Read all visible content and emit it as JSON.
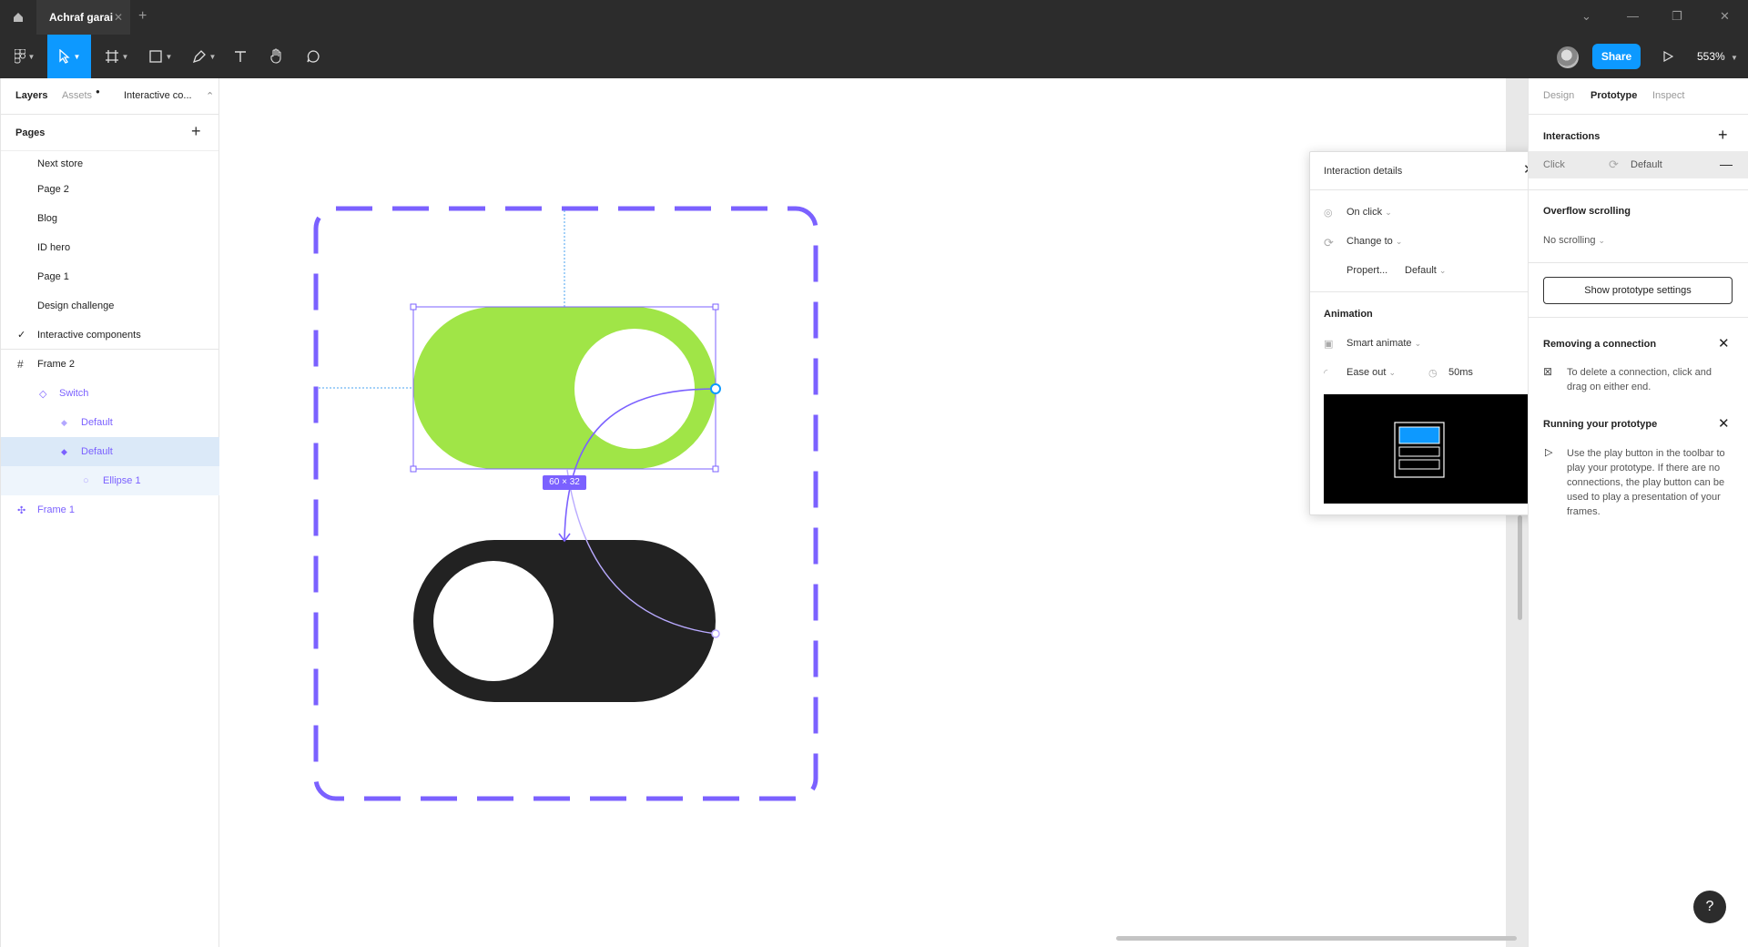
{
  "window": {
    "tab_title": "Achraf garai"
  },
  "toolbar": {
    "share_label": "Share",
    "zoom": "553%"
  },
  "left_panel": {
    "tabs": [
      "Layers",
      "Assets",
      "Interactive co..."
    ],
    "pages_title": "Pages",
    "pages": [
      "Next store",
      "Page 2",
      "Blog",
      "ID hero",
      "Page 1",
      "Design challenge",
      "Interactive components"
    ],
    "layers": [
      "Frame 2",
      "Switch",
      "Default",
      "Default",
      "Ellipse 1",
      "Frame 1"
    ]
  },
  "canvas": {
    "size_badge": "60 × 32"
  },
  "interaction_details": {
    "title": "Interaction details",
    "trigger": "On click",
    "action": "Change to",
    "property_label": "Propert...",
    "property_value": "Default",
    "animation_title": "Animation",
    "animation_type": "Smart animate",
    "easing": "Ease out",
    "duration": "50ms"
  },
  "right_panel": {
    "tabs": [
      "Design",
      "Prototype",
      "Inspect"
    ],
    "interactions_title": "Interactions",
    "interaction_trigger": "Click",
    "interaction_target": "Default",
    "overflow_title": "Overflow scrolling",
    "overflow_value": "No scrolling",
    "settings_button": "Show prototype settings",
    "removing_title": "Removing a connection",
    "removing_text": "To delete a connection, click and drag on either end.",
    "running_title": "Running your prototype",
    "running_text": "Use the play button in the toolbar to play your prototype. If there are no connections, the play button can be used to play a presentation of your frames."
  },
  "colors": {
    "accent": "#0d99ff",
    "purple": "#7b61ff",
    "switch_on": "#a0e547",
    "switch_off": "#222222"
  }
}
